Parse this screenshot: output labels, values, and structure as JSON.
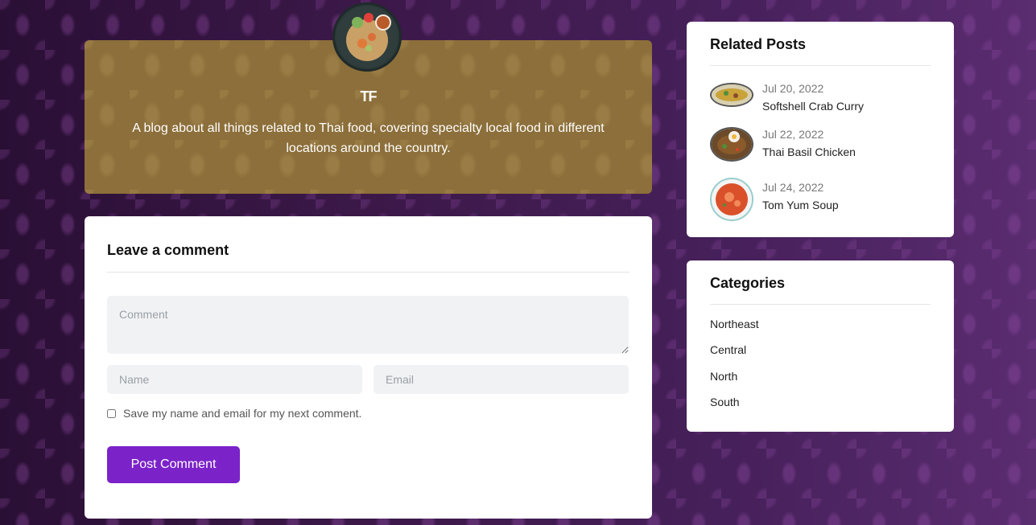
{
  "author": {
    "name": "TF",
    "bio": "A blog about all things related to Thai food, covering specialty local food in different locations around the country."
  },
  "comment_form": {
    "title": "Leave a comment",
    "comment_placeholder": "Comment",
    "name_placeholder": "Name",
    "email_placeholder": "Email",
    "save_label": "Save my name and email for my next comment.",
    "submit_label": "Post Comment"
  },
  "related_posts": {
    "title": "Related Posts",
    "items": [
      {
        "date": "Jul 20, 2022",
        "title": "Softshell Crab Curry"
      },
      {
        "date": "Jul 22, 2022",
        "title": "Thai Basil Chicken"
      },
      {
        "date": "Jul 24, 2022",
        "title": "Tom Yum Soup"
      }
    ]
  },
  "categories": {
    "title": "Categories",
    "items": [
      "Northeast",
      "Central",
      "North",
      "South"
    ]
  },
  "colors": {
    "accent": "#7b22c9",
    "author_card": "#8c6f3a",
    "background": "#3a1846"
  }
}
